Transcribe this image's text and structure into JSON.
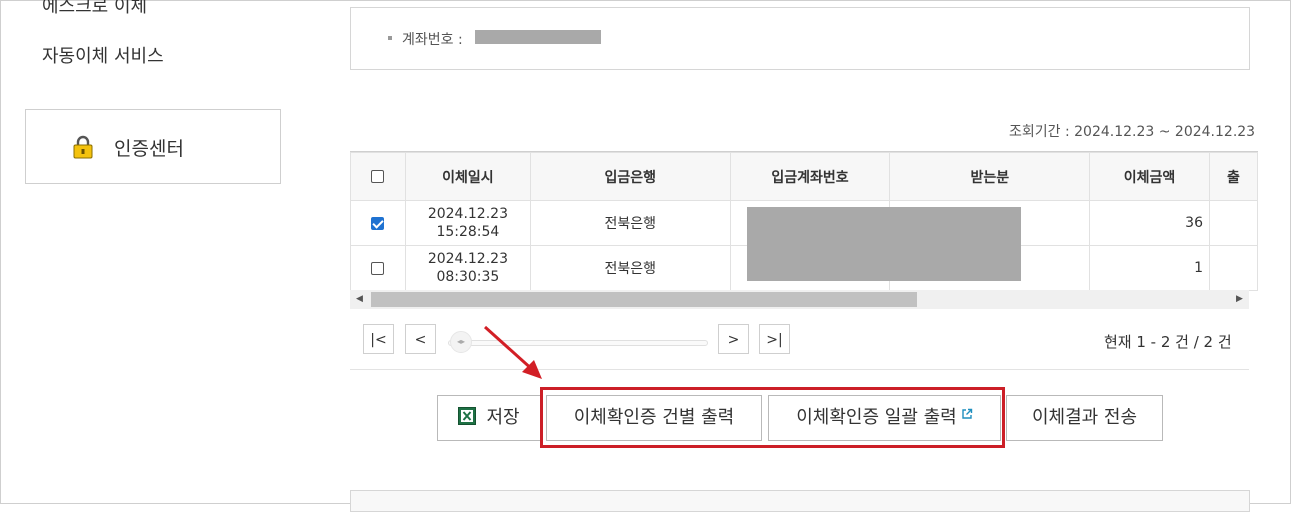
{
  "sidebar": {
    "items": [
      {
        "label": "에스크로 이체"
      },
      {
        "label": "자동이체 서비스"
      }
    ],
    "auth_center": {
      "label": "인증센터",
      "icon": "lock-icon"
    }
  },
  "account": {
    "label": "계좌번호 :"
  },
  "period": {
    "text": "조회기간 : 2024.12.23 ~ 2024.12.23"
  },
  "table": {
    "columns": [
      "",
      "이체일시",
      "입금은행",
      "입금계좌번호",
      "받는분",
      "이체금액",
      "출"
    ],
    "rows": [
      {
        "checked": true,
        "date": "2024.12.23",
        "time": "15:28:54",
        "bank": "전북은행",
        "amount": "36"
      },
      {
        "checked": false,
        "date": "2024.12.23",
        "time": "08:30:35",
        "bank": "전북은행",
        "amount": "1"
      }
    ]
  },
  "pager": {
    "first": "|<",
    "prev": "<",
    "next": ">",
    "last": ">|",
    "status": "현재 1 - 2 건 / 2 건"
  },
  "actions": {
    "save": "저장",
    "print_each": "이체확인증 건별 출력",
    "print_all": "이체확인증 일괄 출력",
    "send_result": "이체결과 전송"
  },
  "colors": {
    "highlight": "#cc1f27",
    "checkbox": "#1f72d1",
    "mask": "#a9a9a9"
  }
}
